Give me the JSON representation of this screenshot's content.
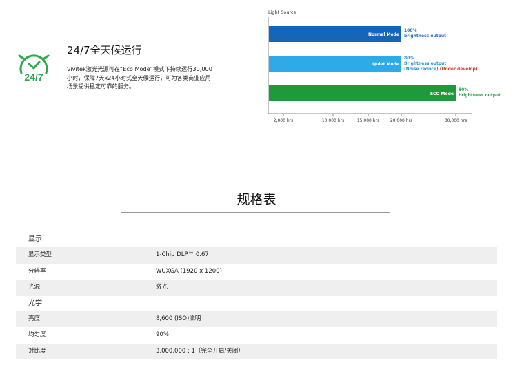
{
  "feature": {
    "icon": "clock-24-7-icon",
    "icon_text": "24/7",
    "accent_color": "#2fa84f",
    "title": "24/7全天候运行",
    "description": "Vivitek激光光源可在“Eco Mode”模式下持续运行30,000小时，保障7天x24小时式全天候运行，可为各类商业应用场景提供稳定可靠的服务。"
  },
  "chart_data": {
    "type": "bar",
    "orientation": "horizontal",
    "title": "Light Source",
    "x_ticks": [
      "2,000 hrs",
      "10,000 hrs",
      "15,000 hrs",
      "20,000 hrs",
      "30,000 hrs"
    ],
    "grid": false,
    "series": [
      {
        "name": "Normal Mode",
        "value": 20000,
        "color": "#1565b8",
        "annotation_lines": [
          "100%",
          "brightness output"
        ],
        "annotation_color": "#1f6fbf"
      },
      {
        "name": "Quiet Mode",
        "value": 20000,
        "color": "#2eaae6",
        "annotation_lines": [
          "80%",
          "Brightness output",
          "(Noise reduce)"
        ],
        "annotation_extra": "(Under develop)",
        "annotation_color": "#2a8fd0",
        "annotation_extra_color": "#e53935"
      },
      {
        "name": "ECO Mode",
        "value": 30000,
        "color": "#1f9a3a",
        "annotation_lines": [
          "80%",
          "brightness output"
        ],
        "annotation_color": "#2aa54a"
      }
    ]
  },
  "specs": {
    "title": "规格表",
    "groups": [
      {
        "label": "显示",
        "rows": [
          {
            "key": "显示类型",
            "value": "1-Chip DLP™ 0.67"
          },
          {
            "key": "分辨率",
            "value": "WUXGA (1920 x 1200)"
          },
          {
            "key": "光源",
            "value": "激光"
          }
        ]
      },
      {
        "label": "光学",
        "rows": [
          {
            "key": "亮度",
            "value": "8,600 (ISO)流明"
          },
          {
            "key": "均匀度",
            "value": "90%"
          },
          {
            "key": "对比度",
            "value": "3,000,000 : 1（完全开启/关闭）"
          }
        ]
      }
    ]
  }
}
